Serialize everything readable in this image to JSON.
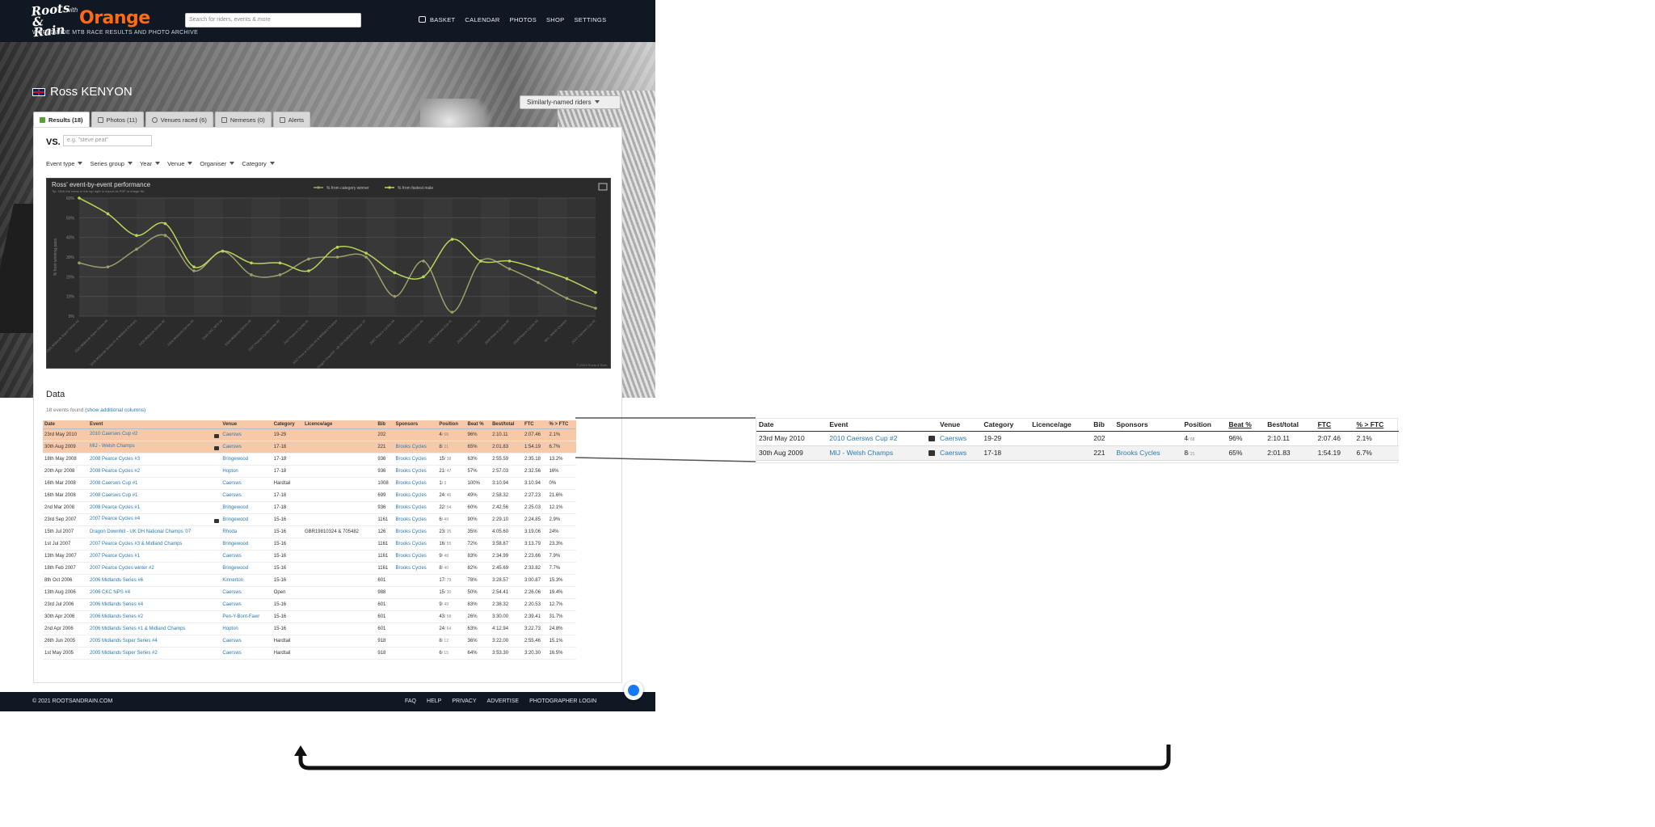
{
  "nav": {
    "logo_roots": "Roots & Rain",
    "logo_with": "with",
    "logo_brand": "Orange",
    "tagline": "WORLDWIDE MTB RACE RESULTS AND PHOTO ARCHIVE",
    "search_placeholder": "Search for riders, events & more",
    "links": [
      "BASKET",
      "CALENDAR",
      "PHOTOS",
      "SHOP",
      "SETTINGS"
    ]
  },
  "profile": {
    "similar_button": "Similarly-named riders",
    "rider_name": "Ross KENYON",
    "tabs": [
      "Results (18)",
      "Photos (11)",
      "Venues raced (6)",
      "Nemeses (0)",
      "Alerts"
    ],
    "vs_label": "VS.",
    "vs_placeholder": "e.g. \"steve peat\"",
    "filters": [
      "Event type",
      "Series group",
      "Year",
      "Venue",
      "Organiser",
      "Category"
    ]
  },
  "chart_data": {
    "type": "line",
    "title": "Ross' event-by-event performance",
    "subtitle": "Tip: Click the menu in the top right to export as PDF or image file",
    "ylabel": "% from winning pace",
    "credit": "© 2021 Roots & Rain",
    "series": [
      {
        "name": "% from category winner",
        "color": "#9e9e6a",
        "values": [
          27,
          25,
          34,
          41,
          23,
          33,
          21,
          21,
          29,
          30,
          30,
          10,
          28,
          2,
          28,
          24,
          17,
          9,
          4
        ]
      },
      {
        "name": "% from fastest male",
        "color": "#b8d65a",
        "values": [
          60,
          52,
          41,
          47,
          25,
          33,
          27,
          27,
          23,
          35,
          32,
          22,
          20,
          39,
          28,
          28,
          24,
          19,
          12
        ]
      }
    ]
  },
  "data": {
    "title": "Data",
    "count_text": "18 events found",
    "show_more": "(show additional columns)",
    "headers": [
      "Date",
      "Event",
      "Venue",
      "Category",
      "Licence/age",
      "Bib",
      "Sponsors",
      "Position",
      "Beat %",
      "Best/total",
      "FTC",
      "% > FTC"
    ],
    "rows": [
      {
        "date": "23rd May 2010",
        "event": "2010 Caersws Cup #2",
        "photo": true,
        "venue": "Caersws",
        "category": "19-29",
        "licence": "",
        "bib": "202",
        "sponsors": "",
        "pos": "4",
        "of": "/ 68",
        "beat": "96%",
        "best": "2:10.11",
        "ftc": "2:07.46",
        "pftc": "2.1%"
      },
      {
        "date": "30th Aug 2009",
        "event": "MIJ - Welsh Champs",
        "photo": true,
        "venue": "Caersws",
        "category": "17-18",
        "licence": "",
        "bib": "221",
        "sponsors": "Brooks Cycles",
        "pos": "8",
        "of": "/ 21",
        "beat": "65%",
        "best": "2:01.83",
        "ftc": "1:54.19",
        "pftc": "6.7%"
      },
      {
        "date": "18th May 2008",
        "event": "2008 Pearce Cycles #3",
        "photo": false,
        "venue": "Bringewood",
        "category": "17-18",
        "licence": "",
        "bib": "936",
        "sponsors": "Brooks Cycles",
        "pos": "15",
        "of": "/ 38",
        "beat": "63%",
        "best": "2:55.59",
        "ftc": "2:35.18",
        "pftc": "13.2%"
      },
      {
        "date": "20th Apr 2008",
        "event": "2008 Pearce Cycles #2",
        "photo": false,
        "venue": "Hopton",
        "category": "17-18",
        "licence": "",
        "bib": "936",
        "sponsors": "Brooks Cycles",
        "pos": "21",
        "of": "/ 47",
        "beat": "57%",
        "best": "2:57.03",
        "ftc": "2:32.56",
        "pftc": "16%"
      },
      {
        "date": "16th Mar 2008",
        "event": "2008 Caersws Cup #1",
        "photo": false,
        "venue": "Caersws",
        "category": "Hardtail",
        "licence": "",
        "bib": "1008",
        "sponsors": "Brooks Cycles",
        "pos": "1",
        "of": "/ 3",
        "beat": "100%",
        "best": "3:10.94",
        "ftc": "3:10.94",
        "pftc": "0%"
      },
      {
        "date": "16th Mar 2008",
        "event": "2008 Caersws Cup #1",
        "photo": false,
        "venue": "Caersws",
        "category": "17-18",
        "licence": "",
        "bib": "699",
        "sponsors": "Brooks Cycles",
        "pos": "24",
        "of": "/ 46",
        "beat": "49%",
        "best": "2:58.32",
        "ftc": "2:27.23",
        "pftc": "21.6%"
      },
      {
        "date": "2nd Mar 2008",
        "event": "2008 Pearce Cycles #1",
        "photo": false,
        "venue": "Bringewood",
        "category": "17-18",
        "licence": "",
        "bib": "936",
        "sponsors": "Brooks Cycles",
        "pos": "22",
        "of": "/ 54",
        "beat": "60%",
        "best": "2:42.56",
        "ftc": "2:25.03",
        "pftc": "12.1%"
      },
      {
        "date": "23rd Sep 2007",
        "event": "2007 Pearce Cycles #4",
        "photo": true,
        "venue": "Bringewood",
        "category": "15-16",
        "licence": "",
        "bib": "1161",
        "sponsors": "Brooks Cycles",
        "pos": "6",
        "of": "/ 49",
        "beat": "90%",
        "best": "2:29.10",
        "ftc": "2:24.85",
        "pftc": "2.9%"
      },
      {
        "date": "15th Jul 2007",
        "event": "Dragon Downhill - UK DH National Champs '07",
        "photo": false,
        "venue": "Rhoda",
        "category": "15-16",
        "licence": "GBR19810324 & 705482",
        "bib": "126",
        "sponsors": "Brooks Cycles",
        "pos": "23",
        "of": "/ 35",
        "beat": "35%",
        "best": "4:05.60",
        "ftc": "3:19.06",
        "pftc": "24%"
      },
      {
        "date": "1st Jul 2007",
        "event": "2007 Pearce Cycles #3 & Midland Champs",
        "photo": false,
        "venue": "Bringewood",
        "category": "15-16",
        "licence": "",
        "bib": "1161",
        "sponsors": "Brooks Cycles",
        "pos": "16",
        "of": "/ 55",
        "beat": "72%",
        "best": "3:58.87",
        "ftc": "3:13.79",
        "pftc": "23.3%"
      },
      {
        "date": "13th May 2007",
        "event": "2007 Pearce Cycles #1",
        "photo": false,
        "venue": "Caersws",
        "category": "15-16",
        "licence": "",
        "bib": "1161",
        "sponsors": "Brooks Cycles",
        "pos": "9",
        "of": "/ 48",
        "beat": "83%",
        "best": "2:34.99",
        "ftc": "2:23.66",
        "pftc": "7.9%"
      },
      {
        "date": "18th Feb 2007",
        "event": "2007 Pearce Cycles winter #2",
        "photo": false,
        "venue": "Bringewood",
        "category": "15-16",
        "licence": "",
        "bib": "1161",
        "sponsors": "Brooks Cycles",
        "pos": "8",
        "of": "/ 40",
        "beat": "82%",
        "best": "2:45.69",
        "ftc": "2:33.82",
        "pftc": "7.7%"
      },
      {
        "date": "8th Oct 2006",
        "event": "2006 Midlands Series #6",
        "photo": false,
        "venue": "Kinnerton",
        "category": "15-16",
        "licence": "",
        "bib": "601",
        "sponsors": "",
        "pos": "17",
        "of": "/ 79",
        "beat": "78%",
        "best": "3:28.57",
        "ftc": "3:00.87",
        "pftc": "15.3%"
      },
      {
        "date": "13th Aug 2006",
        "event": "2006 CKC NPS #4",
        "photo": false,
        "venue": "Caersws",
        "category": "Open",
        "licence": "",
        "bib": "988",
        "sponsors": "",
        "pos": "15",
        "of": "/ 30",
        "beat": "50%",
        "best": "2:54.41",
        "ftc": "2:26.06",
        "pftc": "19.4%"
      },
      {
        "date": "23rd Jul 2006",
        "event": "2006 Midlands Series #4",
        "photo": false,
        "venue": "Caersws",
        "category": "15-16",
        "licence": "",
        "bib": "601",
        "sponsors": "",
        "pos": "9",
        "of": "/ 49",
        "beat": "83%",
        "best": "2:38.32",
        "ftc": "2:20.53",
        "pftc": "12.7%"
      },
      {
        "date": "30th Apr 2006",
        "event": "2006 Midlands Series #2",
        "photo": false,
        "venue": "Pen-Y-Bont-Fawr",
        "category": "15-16",
        "licence": "",
        "bib": "601",
        "sponsors": "",
        "pos": "43",
        "of": "/ 58",
        "beat": "26%",
        "best": "3:30.00",
        "ftc": "2:39.41",
        "pftc": "31.7%"
      },
      {
        "date": "2nd Apr 2006",
        "event": "2006 Midlands Series #1 & Midland Champs",
        "photo": false,
        "venue": "Hopton",
        "category": "15-16",
        "licence": "",
        "bib": "601",
        "sponsors": "",
        "pos": "24",
        "of": "/ 64",
        "beat": "63%",
        "best": "4:12.94",
        "ftc": "3:22.73",
        "pftc": "24.8%"
      },
      {
        "date": "26th Jun 2005",
        "event": "2005 Midlands Super Series #4",
        "photo": false,
        "venue": "Caersws",
        "category": "Hardtail",
        "licence": "",
        "bib": "918",
        "sponsors": "",
        "pos": "8",
        "of": "/ 12",
        "beat": "36%",
        "best": "3:22.00",
        "ftc": "2:55.46",
        "pftc": "15.1%"
      },
      {
        "date": "1st May 2005",
        "event": "2005 Midlands Super Series #2",
        "photo": false,
        "venue": "Caersws",
        "category": "Hardtail",
        "licence": "",
        "bib": "918",
        "sponsors": "",
        "pos": "6",
        "of": "/ 15",
        "beat": "64%",
        "best": "3:53.30",
        "ftc": "3:20.30",
        "pftc": "16.5%"
      }
    ]
  },
  "footer": {
    "copyright": "© 2021 ROOTSANDRAIN.COM",
    "links": [
      "FAQ",
      "HELP",
      "PRIVACY",
      "ADVERTISE",
      "PHOTOGRAPHER LOGIN"
    ]
  },
  "zoom": {
    "headers": [
      "Date",
      "Event",
      "Venue",
      "Category",
      "Licence/age",
      "Bib",
      "Sponsors",
      "Position",
      "Beat %",
      "Best/total",
      "FTC",
      "% > FTC"
    ],
    "rows": [
      {
        "date": "23rd May 2010",
        "event": "2010 Caersws Cup #2",
        "venue": "Caersws",
        "category": "19-29",
        "licence": "",
        "bib": "202",
        "sponsors": "",
        "pos": "4",
        "of": "/ 68",
        "beat": "96%",
        "best": "2:10.11",
        "ftc": "2:07.46",
        "pftc": "2.1%"
      },
      {
        "date": "30th Aug 2009",
        "event": "MIJ - Welsh Champs",
        "venue": "Caersws",
        "category": "17-18",
        "licence": "",
        "bib": "221",
        "sponsors": "Brooks Cycles",
        "pos": "8",
        "of": "/ 21",
        "beat": "65%",
        "best": "2:01.83",
        "ftc": "1:54.19",
        "pftc": "6.7%"
      }
    ]
  }
}
